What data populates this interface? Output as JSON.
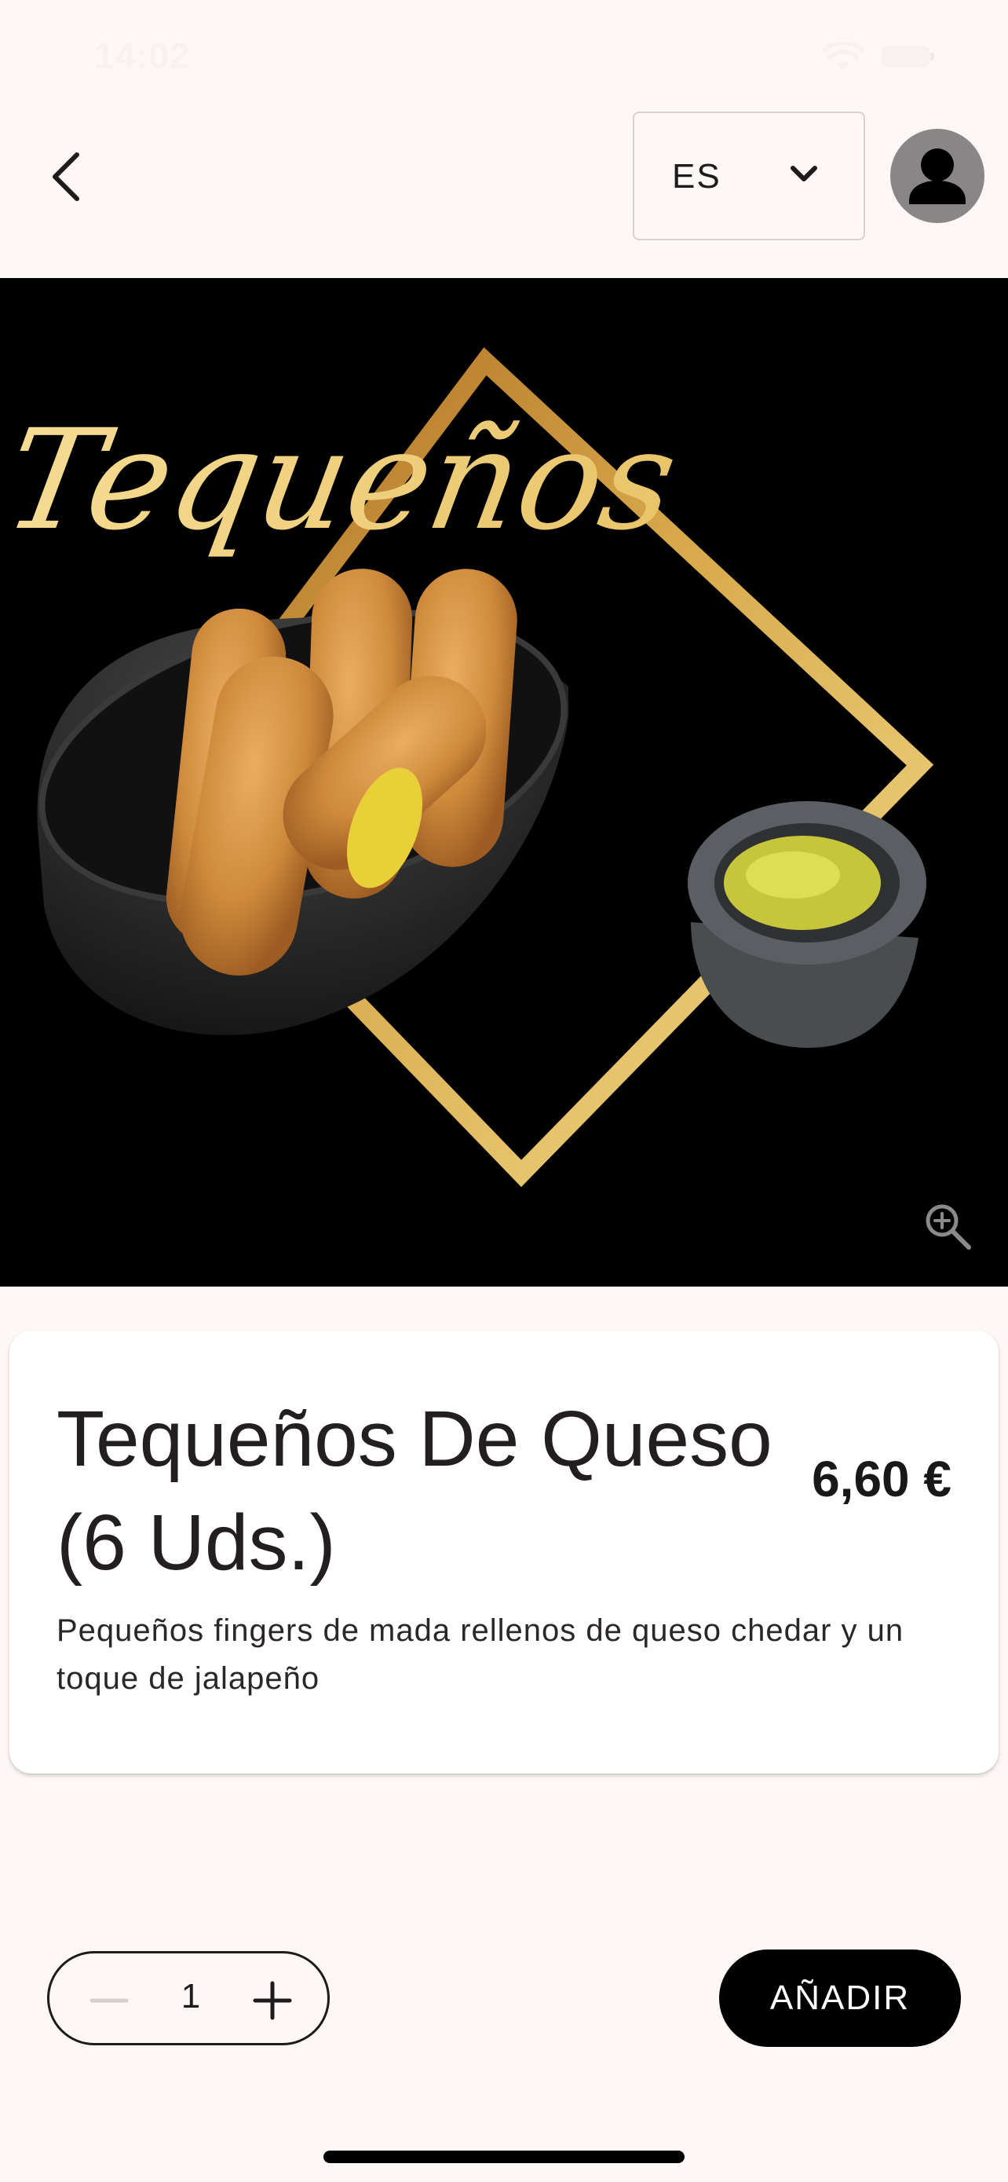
{
  "status_bar": {
    "time": "14:02"
  },
  "header": {
    "language": {
      "selected": "ES"
    }
  },
  "hero": {
    "title_script": "Tequeños"
  },
  "product": {
    "name": "Tequeños De Queso (6 Uds.)",
    "price": "6,60 €",
    "description": "Pequeños fingers de mada rellenos de queso chedar y un toque de jalapeño"
  },
  "cart": {
    "quantity": "1",
    "add_label": "AÑADIR"
  },
  "icons": {
    "back": "chevron-left-icon",
    "language_dropdown": "chevron-down-icon",
    "avatar": "person-icon",
    "zoom": "zoom-in-icon",
    "decrement": "minus-icon",
    "increment": "plus-icon"
  },
  "colors": {
    "background": "#fdf7f6",
    "primary_button": "#000000",
    "card": "#ffffff",
    "gold": "#d8a84a"
  }
}
